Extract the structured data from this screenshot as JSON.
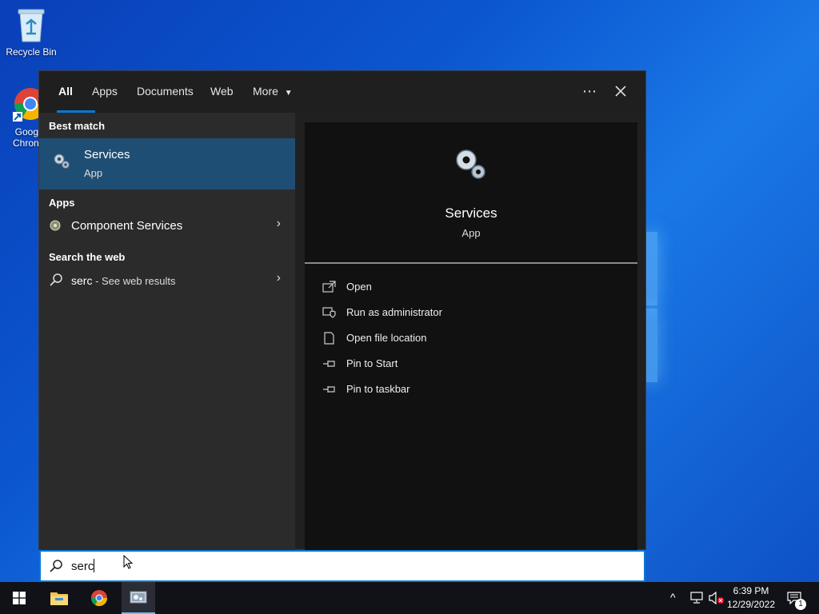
{
  "desktop": {
    "recycle_bin_label": "Recycle Bin",
    "chrome_label_line1": "Goog",
    "chrome_label_line2": "Chron"
  },
  "tabs": [
    "All",
    "Apps",
    "Documents",
    "Web",
    "More"
  ],
  "topbar": {
    "more_icon": "ellipsis-icon",
    "close_icon": "close-icon"
  },
  "best_match": {
    "header": "Best match",
    "title": "Services",
    "subtitle": "App"
  },
  "apps": {
    "header": "Apps",
    "items": [
      {
        "label": "Component Services"
      }
    ]
  },
  "web": {
    "header": "Search the web",
    "query": "serc",
    "suffix": " - See web results"
  },
  "detail": {
    "title": "Services",
    "subtitle": "App",
    "actions": [
      "Open",
      "Run as administrator",
      "Open file location",
      "Pin to Start",
      "Pin to taskbar"
    ]
  },
  "search": {
    "value": "serc"
  },
  "tray": {
    "time": "6:39 PM",
    "date": "12/29/2022",
    "notification_count": "1"
  },
  "colors": {
    "accent": "#0a78d7",
    "selected_row": "#1f4e74"
  }
}
